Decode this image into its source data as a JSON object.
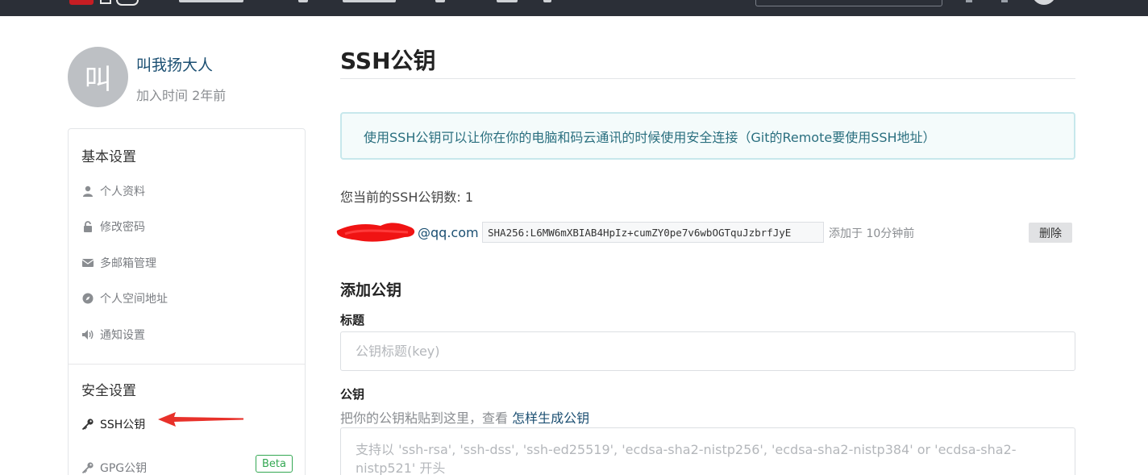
{
  "profile": {
    "avatar_text": "叫",
    "username": "叫我扬大人",
    "joined": "加入时间 2年前"
  },
  "sidebar": {
    "basic_title": "基本设置",
    "basic_items": [
      {
        "label": "个人资料",
        "icon": "user-icon"
      },
      {
        "label": "修改密码",
        "icon": "lock-icon"
      },
      {
        "label": "多邮箱管理",
        "icon": "envelope-icon"
      },
      {
        "label": "个人空间地址",
        "icon": "compass-icon"
      },
      {
        "label": "通知设置",
        "icon": "speaker-icon"
      }
    ],
    "security_title": "安全设置",
    "security_items": [
      {
        "label": "SSH公钥",
        "icon": "key-icon",
        "active": true
      },
      {
        "label": "GPG公钥",
        "icon": "key-icon",
        "badge": "Beta"
      }
    ]
  },
  "main": {
    "title": "SSH公钥",
    "info": "使用SSH公钥可以让你在你的电脑和码云通讯的时候使用安全连接（Git的Remote要使用SSH地址）",
    "key_count": "您当前的SSH公钥数: 1",
    "keys": [
      {
        "email": "@qq.com",
        "fingerprint": "SHA256:L6MW6mXBIAB4HpIz+cumZY0pe7v6wbOGTquJzbrfJyE",
        "added": "添加于 10分钟前",
        "delete_label": "删除"
      }
    ],
    "add_title": "添加公钥",
    "title_label": "标题",
    "title_placeholder": "公钥标题(key)",
    "key_label": "公钥",
    "helper_prefix": "把你的公钥粘贴到这里，查看 ",
    "helper_link": "怎样生成公钥",
    "key_placeholder": "支持以 'ssh-rsa', 'ssh-dss', 'ssh-ed25519', 'ecdsa-sha2-nistp256', 'ecdsa-sha2-nistp384' or 'ecdsa-sha2-nistp521' 开头"
  },
  "colors": {
    "topbar": "#2b2f37",
    "brand": "#c71d23",
    "link": "#1b4f72",
    "info_border": "#c7e8ec",
    "beta": "#34a853",
    "annotation_arrow": "#e8312a"
  }
}
